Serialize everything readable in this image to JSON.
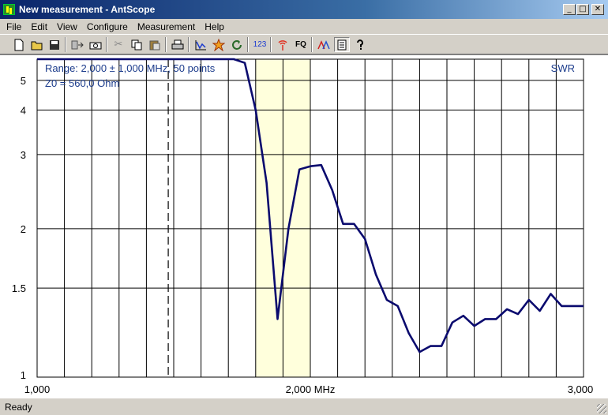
{
  "window": {
    "title": "New measurement - AntScope",
    "minimize_glyph": "_",
    "maximize_glyph": "□",
    "close_glyph": "✕"
  },
  "menu": [
    "File",
    "Edit",
    "View",
    "Configure",
    "Measurement",
    "Help"
  ],
  "toolbar": {
    "freq_label": "FQ",
    "numeric_label": "123"
  },
  "status": {
    "text": "Ready"
  },
  "chart_data": {
    "type": "line",
    "info_range": "Range: 2,000 ± 1,000 MHz, 50 points",
    "info_z0": "Z0 = 560,0 Ohm",
    "series_label": "SWR",
    "xlim": [
      1.0,
      3.0
    ],
    "ylim": [
      1,
      6
    ],
    "y_scale": "swr",
    "x_tick_labels": [
      {
        "value": 1.0,
        "label": "1,000"
      },
      {
        "value": 2.0,
        "label": "2,000 MHz"
      },
      {
        "value": 3.0,
        "label": "3,000"
      }
    ],
    "y_tick_labels": [
      "1",
      "1.5",
      "2",
      "3",
      "4",
      "5"
    ],
    "highlight_band": [
      1.8,
      2.0
    ],
    "marker_x": 1.48,
    "line_color": "#0a0a6e",
    "band_color": "#ffffdc",
    "x": [
      1.0,
      1.04,
      1.08,
      1.12,
      1.16,
      1.2,
      1.24,
      1.28,
      1.32,
      1.36,
      1.4,
      1.44,
      1.48,
      1.52,
      1.56,
      1.6,
      1.64,
      1.68,
      1.72,
      1.76,
      1.8,
      1.84,
      1.88,
      1.92,
      1.96,
      2.0,
      2.04,
      2.08,
      2.12,
      2.16,
      2.2,
      2.24,
      2.28,
      2.32,
      2.36,
      2.4,
      2.44,
      2.48,
      2.52,
      2.56,
      2.6,
      2.64,
      2.68,
      2.72,
      2.76,
      2.8,
      2.84,
      2.88,
      2.92,
      2.96,
      3.0
    ],
    "y": [
      6.0,
      6.0,
      6.0,
      6.0,
      6.0,
      6.0,
      6.0,
      6.0,
      6.0,
      6.0,
      6.0,
      6.0,
      6.0,
      6.0,
      6.0,
      6.0,
      6.0,
      6.0,
      6.0,
      5.8,
      4.0,
      2.55,
      1.3,
      2.0,
      2.75,
      2.8,
      2.82,
      2.45,
      2.05,
      2.05,
      1.9,
      1.6,
      1.42,
      1.38,
      1.22,
      1.12,
      1.15,
      1.15,
      1.28,
      1.32,
      1.26,
      1.3,
      1.3,
      1.36,
      1.33,
      1.42,
      1.35,
      1.46,
      1.38,
      1.38,
      1.38
    ]
  }
}
